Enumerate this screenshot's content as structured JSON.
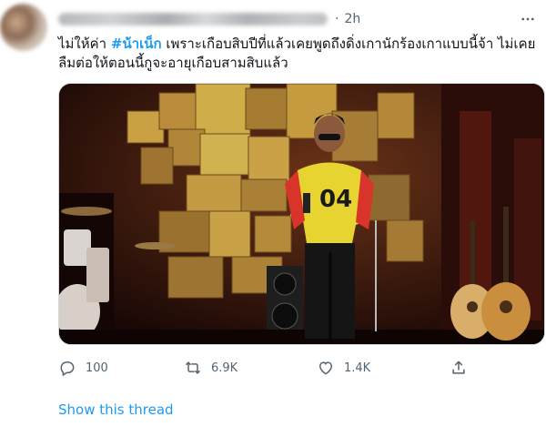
{
  "header": {
    "dot": "·",
    "time": "2h"
  },
  "tweet": {
    "text_before": "ไม่ให้ค่า ",
    "hashtag": "#น้าเน็ก",
    "text_after": " เพราะเกือบสิบปีที่แล้วเคยพูดถึงดิ่งเกานักร้องเกาแบบนี้จ้า ไม่เคยลืมต่อให้ตอนนี้กูจะอายุเกือบสามสิบแล้ว"
  },
  "actions": {
    "replies": "100",
    "retweets": "6.9K",
    "likes": "1.4K"
  },
  "icons": {
    "reply": "reply-icon",
    "retweet": "retweet-icon",
    "like": "heart-icon",
    "share": "share-icon",
    "more": "more-icon"
  },
  "colors": {
    "accent": "#1d9bf0",
    "secondary_text": "#536471"
  },
  "show_thread": "Show this thread"
}
